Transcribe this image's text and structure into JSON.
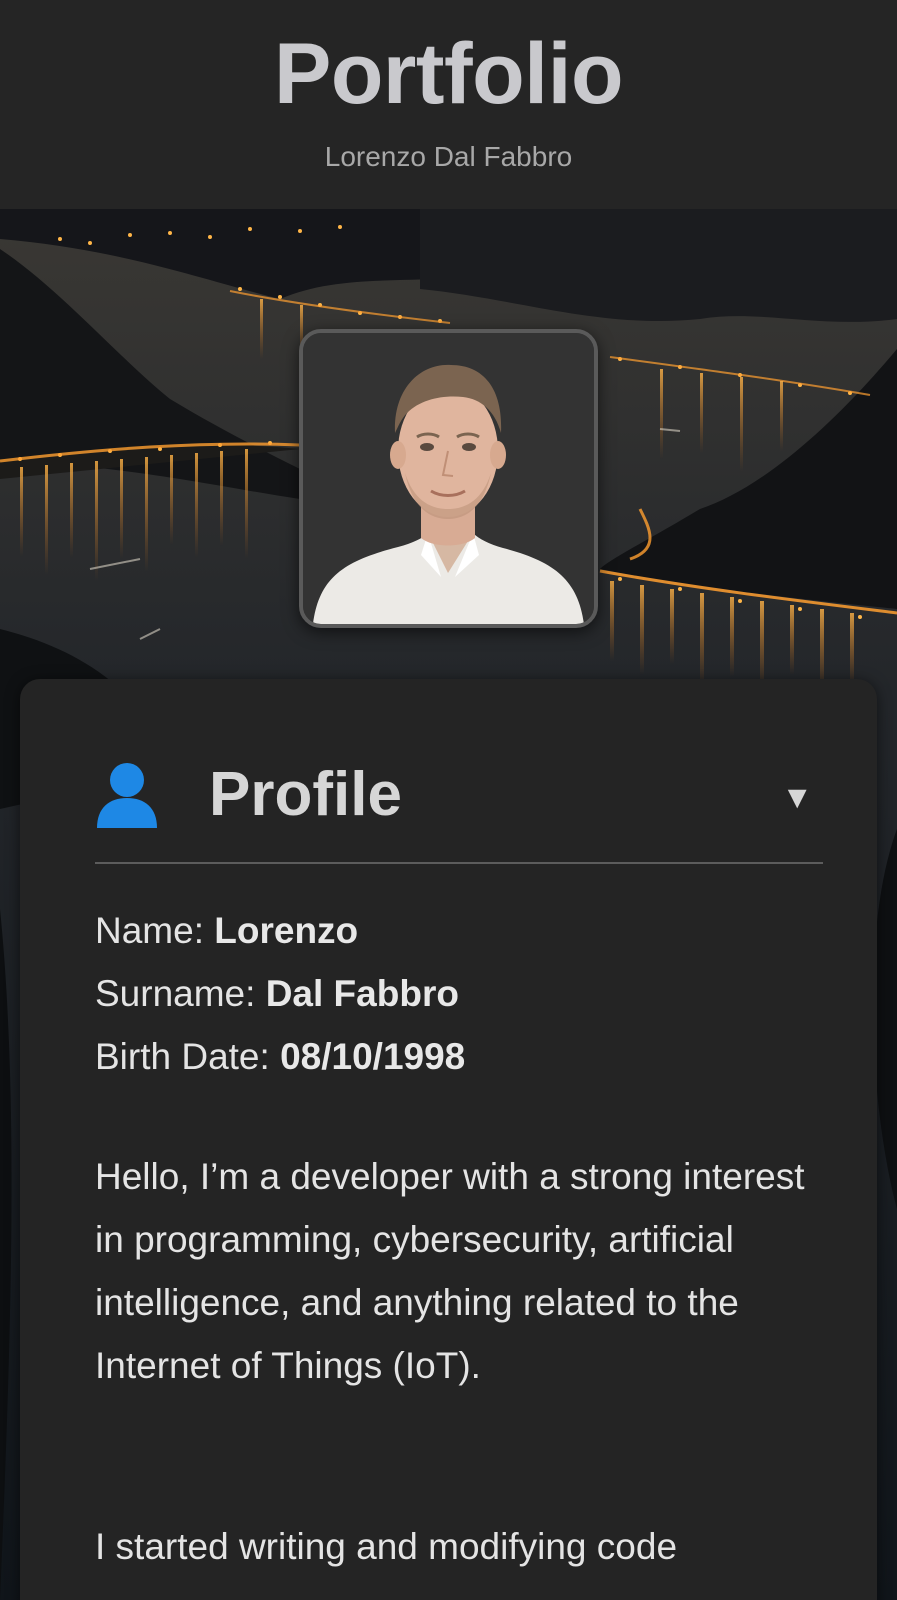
{
  "header": {
    "title": "Portfolio",
    "subtitle": "Lorenzo Dal Fabbro"
  },
  "hero": {
    "background_icon": "night-lake-landscape",
    "avatar_icon": "profile-photo"
  },
  "profile": {
    "icon": "user-icon",
    "title": "Profile",
    "toggle_glyph": "▼",
    "fields": [
      {
        "label": "Name: ",
        "value": "Lorenzo"
      },
      {
        "label": "Surname: ",
        "value": "Dal Fabbro"
      },
      {
        "label": "Birth Date: ",
        "value": "08/10/1998"
      }
    ],
    "bio": [
      "Hello, I’m a developer with a strong interest in programming, cybersecurity, artificial intelligence, and anything related to the Internet of Things (IoT).",
      "I started writing and modifying code"
    ]
  },
  "colors": {
    "header_bg": "#252525",
    "card_bg": "#242424",
    "title_text": "#c9c9cd",
    "icon_blue": "#1e88e5"
  }
}
